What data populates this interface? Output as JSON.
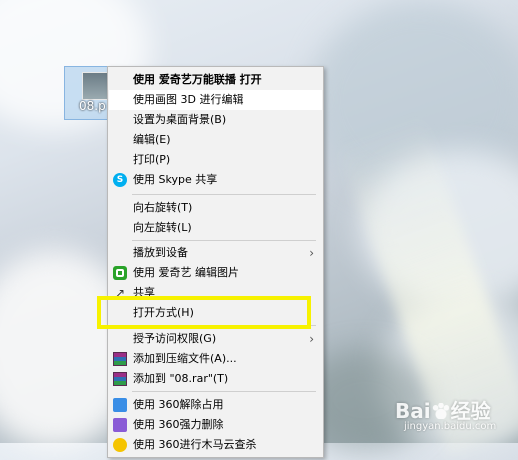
{
  "desktop": {
    "file": {
      "name": "08.p"
    }
  },
  "menu": {
    "items": [
      {
        "label": "使用 爱奇艺万能联播 打开",
        "icon": "none"
      },
      {
        "label": "使用画图 3D 进行编辑",
        "icon": "none"
      },
      {
        "label": "设置为桌面背景(B)",
        "icon": "none"
      },
      {
        "label": "编辑(E)",
        "icon": "none"
      },
      {
        "label": "打印(P)",
        "icon": "none"
      },
      {
        "label": "使用 Skype 共享",
        "icon": "skype-icon"
      },
      {
        "label": "向右旋转(T)",
        "icon": "none"
      },
      {
        "label": "向左旋转(L)",
        "icon": "none"
      },
      {
        "label": "播放到设备",
        "icon": "none"
      },
      {
        "label": "使用 爱奇艺 编辑图片",
        "icon": "iqiyi-icon"
      },
      {
        "label": "共享",
        "icon": "share-icon"
      },
      {
        "label": "打开方式(H)",
        "icon": "none"
      },
      {
        "label": "授予访问权限(G)",
        "icon": "none"
      },
      {
        "label": "添加到压缩文件(A)...",
        "icon": "winrar-icon"
      },
      {
        "label": "添加到 \"08.rar\"(T)",
        "icon": "winrar-icon"
      },
      {
        "label": "使用 360解除占用",
        "icon": "360-unlock-icon"
      },
      {
        "label": "使用 360强力删除",
        "icon": "360-delete-icon"
      },
      {
        "label": "使用 360进行木马云查杀",
        "icon": "360-scan-icon"
      }
    ],
    "skype_glyph": "S",
    "share_glyph": "↗",
    "submenu_arrow": "›"
  },
  "watermark": {
    "brand_left": "Bai",
    "brand_right": "经验",
    "url": "jingyan.baidu.com"
  },
  "colors": {
    "highlight": "#f7f200",
    "menu_bg": "#f2f2f2",
    "skype": "#00aff0",
    "iqiyi": "#2aa329"
  }
}
